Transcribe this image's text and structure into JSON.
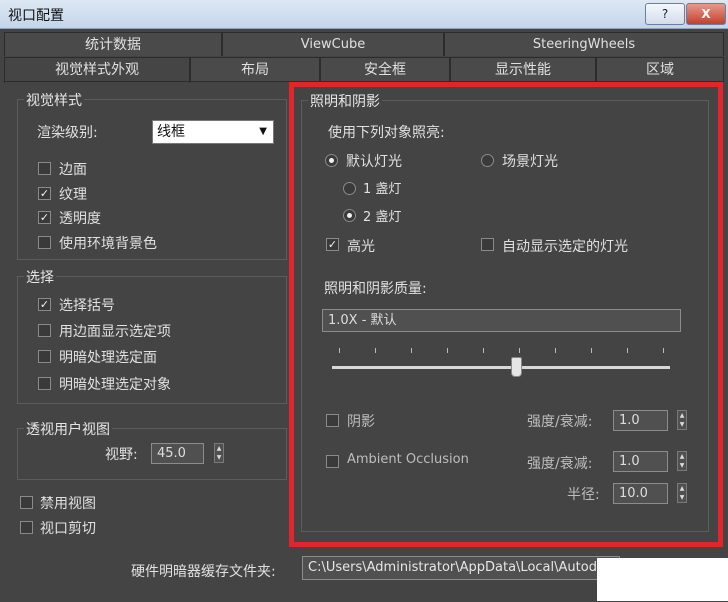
{
  "window": {
    "title": "视口配置",
    "help_label": "?",
    "close_label": "X"
  },
  "tabs": {
    "row1": [
      "统计数据",
      "ViewCube",
      "SteeringWheels"
    ],
    "row2": [
      "视觉样式外观",
      "布局",
      "安全框",
      "显示性能",
      "区域"
    ]
  },
  "visual_style": {
    "title": "视觉样式",
    "render_level_label": "渲染级别:",
    "render_level_value": "线框",
    "options": [
      {
        "label": "边面",
        "checked": false
      },
      {
        "label": "纹理",
        "checked": true
      },
      {
        "label": "透明度",
        "checked": true
      },
      {
        "label": "使用环境背景色",
        "checked": false
      }
    ]
  },
  "selection": {
    "title": "选择",
    "options": [
      {
        "label": "选择括号",
        "checked": true
      },
      {
        "label": "用边面显示选定项",
        "checked": false
      },
      {
        "label": "明暗处理选定面",
        "checked": false
      },
      {
        "label": "明暗处理选定对象",
        "checked": false
      }
    ]
  },
  "perspective": {
    "title": "透视用户视图",
    "fov_label": "视野:",
    "fov_value": "45.0"
  },
  "disable_view": {
    "label": "禁用视图",
    "checked": false
  },
  "viewport_clip": {
    "label": "视口剪切",
    "checked": false
  },
  "lighting": {
    "title": "照明和阴影",
    "illuminate_label": "使用下列对象照亮:",
    "default_lights": {
      "label": "默认灯光",
      "selected": true
    },
    "scene_lights": {
      "label": "场景灯光",
      "selected": false
    },
    "one_light": {
      "label": "1 盏灯",
      "selected": false
    },
    "two_lights": {
      "label": "2 盏灯",
      "selected": true
    },
    "highlights": {
      "label": "高光",
      "checked": true
    },
    "auto_display": {
      "label": "自动显示选定的灯光",
      "checked": false
    },
    "quality_label": "照明和阴影质量:",
    "quality_value": "1.0X - 默认",
    "quality_slider_fraction": 0.55,
    "shadows": {
      "label": "阴影",
      "checked": false
    },
    "shadow_intensity_label": "强度/衰减:",
    "shadow_intensity_value": "1.0",
    "ambient_occlusion": {
      "label": "Ambient Occlusion",
      "checked": false
    },
    "ao_intensity_label": "强度/衰减:",
    "ao_intensity_value": "1.0",
    "radius_label": "半径:",
    "radius_value": "10.0"
  },
  "cache": {
    "label": "硬件明暗器缓存文件夹:",
    "path": "C:\\Users\\Administrator\\AppData\\Local\\Autodesk"
  },
  "colors": {
    "highlight_border": "#e0262c",
    "background": "#444444"
  }
}
